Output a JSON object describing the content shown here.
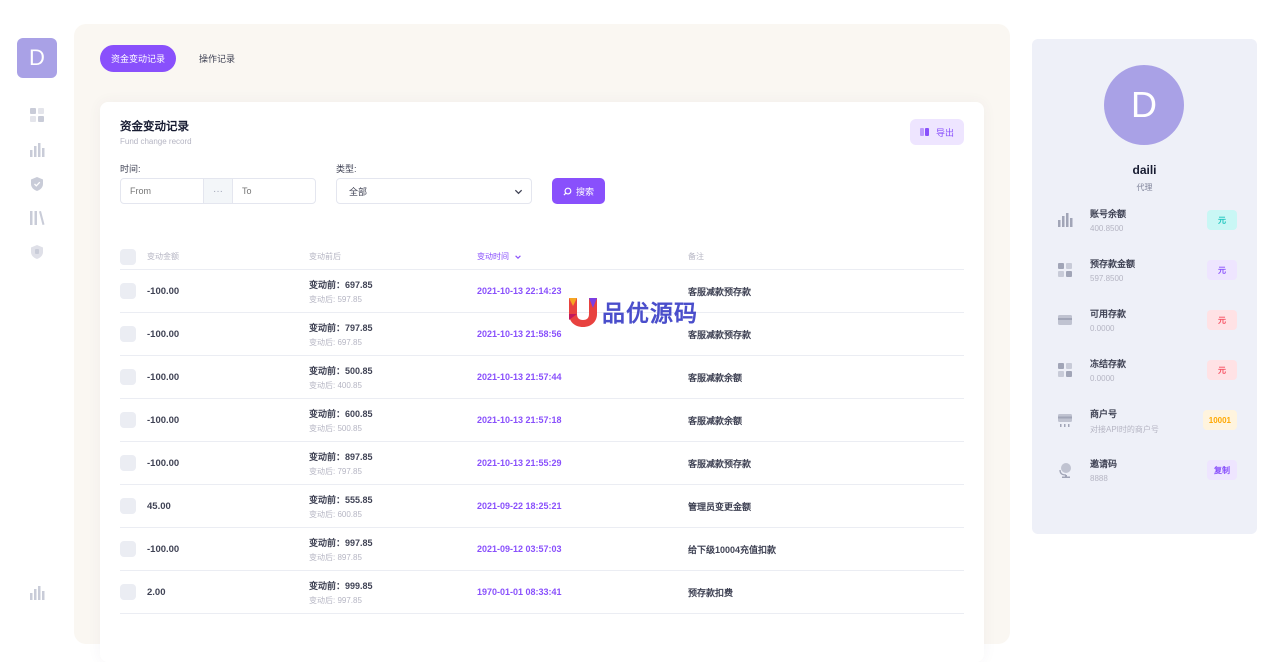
{
  "sidebar": {
    "logo_letter": "D",
    "icons": [
      "dashboard-icon",
      "chart-icon",
      "shield-icon",
      "library-icon",
      "shield-alt-icon",
      "chart-bottom-icon"
    ]
  },
  "tabs": [
    {
      "label": "资金变动记录",
      "active": true
    },
    {
      "label": "操作记录",
      "active": false
    }
  ],
  "card": {
    "title": "资金变动记录",
    "subtitle": "Fund change record",
    "export_label": "导出"
  },
  "filters": {
    "time_label": "时间:",
    "from_placeholder": "From",
    "separator": "···",
    "to_placeholder": "To",
    "type_label": "类型:",
    "type_selected": "全部",
    "search_label": "搜索"
  },
  "table": {
    "columns": [
      "变动金额",
      "变动前后",
      "变动时间",
      "备注"
    ],
    "rows": [
      {
        "amount": "-100.00",
        "before": "变动前：697.85",
        "after": "变动后: 597.85",
        "time": "2021-10-13 22:14:23",
        "note": "客服减款预存款"
      },
      {
        "amount": "-100.00",
        "before": "变动前：797.85",
        "after": "变动后: 697.85",
        "time": "2021-10-13 21:58:56",
        "note": "客服减款预存款"
      },
      {
        "amount": "-100.00",
        "before": "变动前：500.85",
        "after": "变动后: 400.85",
        "time": "2021-10-13 21:57:44",
        "note": "客服减款余额"
      },
      {
        "amount": "-100.00",
        "before": "变动前：600.85",
        "after": "变动后: 500.85",
        "time": "2021-10-13 21:57:18",
        "note": "客服减款余额"
      },
      {
        "amount": "-100.00",
        "before": "变动前：897.85",
        "after": "变动后: 797.85",
        "time": "2021-10-13 21:55:29",
        "note": "客服减款预存款"
      },
      {
        "amount": "45.00",
        "before": "变动前：555.85",
        "after": "变动后: 600.85",
        "time": "2021-09-22 18:25:21",
        "note": "管理员变更金额"
      },
      {
        "amount": "-100.00",
        "before": "变动前：997.85",
        "after": "变动后: 897.85",
        "time": "2021-09-12 03:57:03",
        "note": "给下级10004充值扣款"
      },
      {
        "amount": "2.00",
        "before": "变动前：999.85",
        "after": "变动后: 997.85",
        "time": "1970-01-01 08:33:41",
        "note": "预存款扣费"
      }
    ]
  },
  "watermark": {
    "text": "品优源码"
  },
  "profile": {
    "avatar_letter": "D",
    "name": "daili",
    "role": "代理",
    "stats": [
      {
        "label": "账号余额",
        "value": "400.8500",
        "badge": "元",
        "badge_bg": "#c9f7f5",
        "badge_color": "#1bc5bd",
        "icon": "chart-icon"
      },
      {
        "label": "预存款金额",
        "value": "597.8500",
        "badge": "元",
        "badge_bg": "#eee5ff",
        "badge_color": "#8950fc",
        "icon": "dashboard-icon"
      },
      {
        "label": "可用存款",
        "value": "0.0000",
        "badge": "元",
        "badge_bg": "#ffe2e5",
        "badge_color": "#f64e60",
        "icon": "credit-card-icon"
      },
      {
        "label": "冻结存款",
        "value": "0.0000",
        "badge": "元",
        "badge_bg": "#ffe2e5",
        "badge_color": "#f64e60",
        "icon": "dashboard-icon"
      },
      {
        "label": "商户号",
        "value": "对接API时的商户号",
        "badge": "10001",
        "badge_bg": "#fff4de",
        "badge_color": "#ffa800",
        "icon": "card-reader-icon"
      },
      {
        "label": "邀请码",
        "value": "8888",
        "badge": "复制",
        "badge_bg": "#eee5ff",
        "badge_color": "#8950fc",
        "icon": "globe-icon"
      }
    ]
  },
  "colors": {
    "accent": "#8950fc",
    "avatar": "#a9a1e6",
    "panel_bg": "#eef0f8",
    "main_bg": "#faf7f2"
  }
}
